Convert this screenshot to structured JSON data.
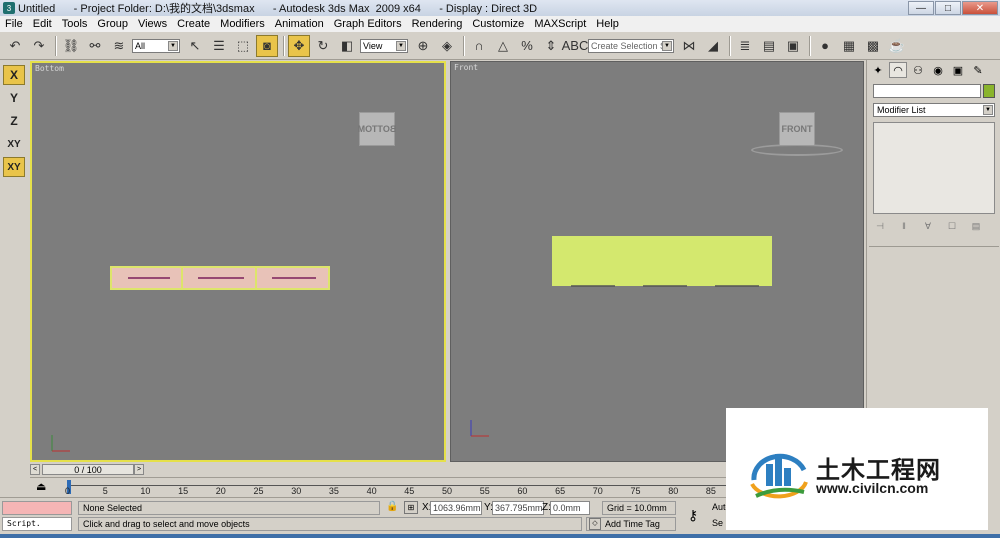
{
  "window": {
    "title": "Untitled      - Project Folder: D:\\我的文档\\3dsmax      - Autodesk 3ds Max  2009 x64      - Display : Direct 3D",
    "min": "—",
    "max": "□",
    "close": "✕"
  },
  "menu": [
    "File",
    "Edit",
    "Tools",
    "Group",
    "Views",
    "Create",
    "Modifiers",
    "Animation",
    "Graph Editors",
    "Rendering",
    "Customize",
    "MAXScript",
    "Help"
  ],
  "toolbar": {
    "filter_value": "All",
    "refcoord_value": "View",
    "named_selection_placeholder": "Create Selection Se"
  },
  "axis_constraints": [
    "X",
    "Y",
    "Z",
    "XY",
    "XY"
  ],
  "viewports": {
    "left": {
      "label": "Bottom",
      "cube_label": "BOTTOM"
    },
    "right": {
      "label": "Front",
      "cube_label": "FRONT"
    }
  },
  "command_panel": {
    "modifier_list": "Modifier List",
    "object_color": "#8ab42c"
  },
  "time_slider": {
    "frame_label": "0 / 100",
    "prev": "<",
    "next": ">"
  },
  "track_ticks": [
    "0",
    "5",
    "10",
    "15",
    "20",
    "25",
    "30",
    "35",
    "40",
    "45",
    "50",
    "55",
    "60",
    "65",
    "70",
    "75",
    "80",
    "85"
  ],
  "status": {
    "script_label": "Script.",
    "selection": "None Selected",
    "prompt": "Click and drag to select and move objects",
    "x_label": "X:",
    "x_value": "1063.96mm",
    "y_label": "Y:",
    "y_value": "367.795mm",
    "z_label": "Z:",
    "z_value": "0.0mm",
    "grid": "Grid = 10.0mm",
    "time_tag": "Add Time Tag",
    "auto": "Auto",
    "set": "Se"
  },
  "watermark": {
    "title": "土木工程网",
    "url": "www.civilcn.com"
  }
}
